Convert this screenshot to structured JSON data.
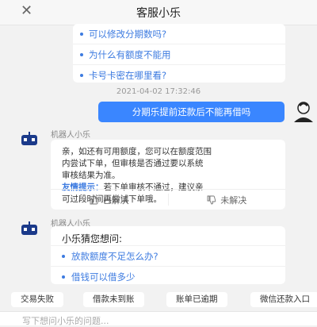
{
  "header": {
    "title": "客服小乐",
    "close_icon": "close-icon"
  },
  "faq": {
    "questions": [
      "可以修改分期数吗?",
      "为什么有额度不能用",
      "卡号卡密在哪里看?"
    ]
  },
  "timestamp": "2021-04-02 17:32:46",
  "user_message": "分期乐提前还款后不能再借吗",
  "bot_name": "机器人小乐",
  "answer": {
    "line1": "亲，如还有可用额度，您可以在额度范围",
    "line2": "内尝试下单，但审核是否通过要以系统",
    "line3": "审核结果为准。",
    "tip_label": "友情提示：",
    "tip_text": "若下单审核不通过，建议亲",
    "line5": "可过段时间再尝试下单哦。"
  },
  "feedback": {
    "solved": "已解决",
    "unsolved": "未解决"
  },
  "bot_name_2": "机器人小乐",
  "guess": {
    "title": "小乐猜您想问:",
    "questions": [
      "放款额度不足怎么办?",
      "借钱可以借多少"
    ]
  },
  "quick_chips": [
    "交易失败",
    "借款未到账",
    "账单已逾期",
    "微信还款入口"
  ],
  "input": {
    "placeholder": "写下想问小乐的问题..."
  },
  "colors": {
    "accent": "#3a86ff",
    "link": "#3d7be0",
    "background": "#f2f2f2"
  }
}
